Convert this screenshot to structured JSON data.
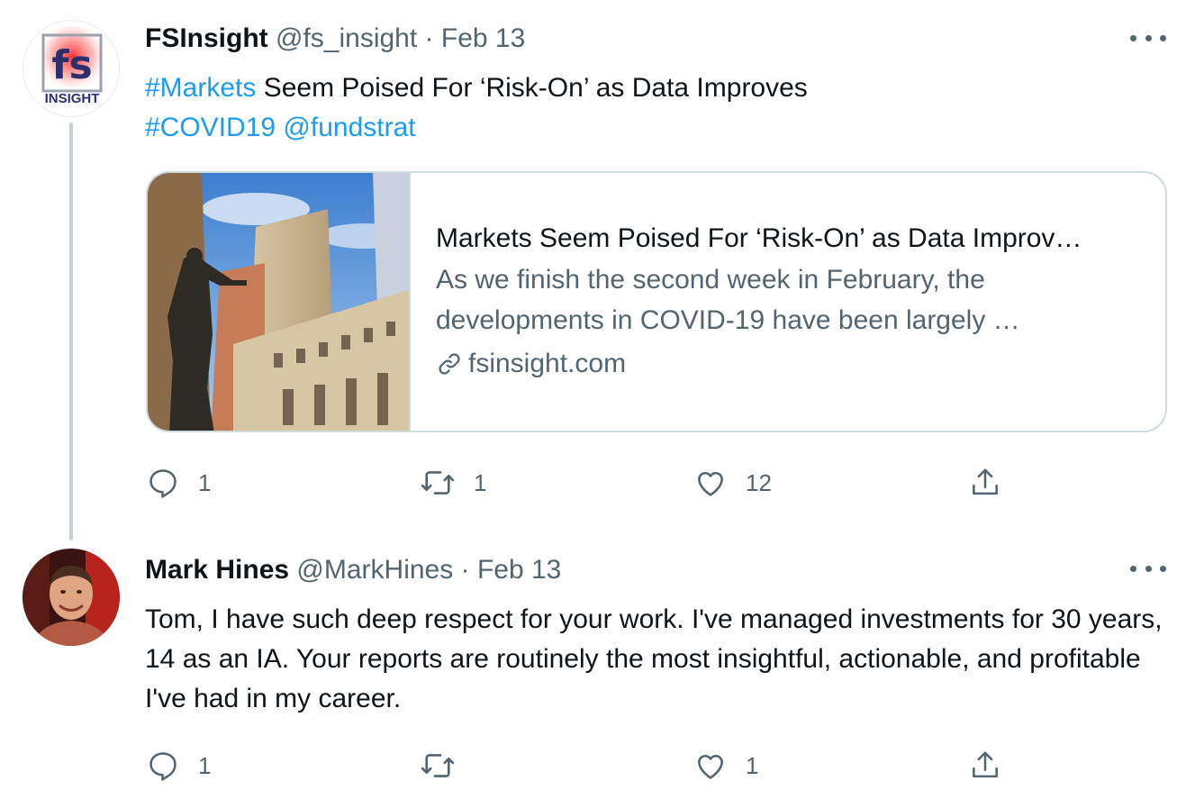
{
  "tweets": [
    {
      "author_name": "FSInsight",
      "handle": "@fs_insight",
      "separator": "·",
      "date": "Feb 13",
      "avatar_text": "fs",
      "avatar_subtext": "INSIGHT",
      "text_parts": {
        "hashtag1": "#Markets",
        "line1": " Seem Poised For ‘Risk-On’ as Data Improves",
        "hashtag2": "#COVID19",
        "mention": "@fundstrat"
      },
      "card": {
        "title": "Markets Seem Poised For ‘Risk-On’ as Data Improv…",
        "description": "As we finish the second week in February, the developments in COVID-19 have been largely …",
        "domain": "fsinsight.com"
      },
      "actions": {
        "reply_count": "1",
        "retweet_count": "1",
        "like_count": "12"
      }
    },
    {
      "author_name": "Mark Hines",
      "handle": "@MarkHines",
      "separator": "·",
      "date": "Feb 13",
      "text": "Tom, I have such deep respect for your work. I've managed investments for 30 years, 14 as an IA.  Your reports are routinely the most insightful, actionable, and profitable I've had in my career.",
      "actions": {
        "reply_count": "1",
        "retweet_count": "",
        "like_count": "1"
      }
    }
  ],
  "colors": {
    "link": "#1d9bf0",
    "secondary_text": "#536471",
    "border": "#cfd9de",
    "thread_line": "#c4cfd6"
  },
  "icons": [
    "reply-icon",
    "retweet-icon",
    "like-icon",
    "share-icon",
    "more-icon",
    "link-icon"
  ]
}
